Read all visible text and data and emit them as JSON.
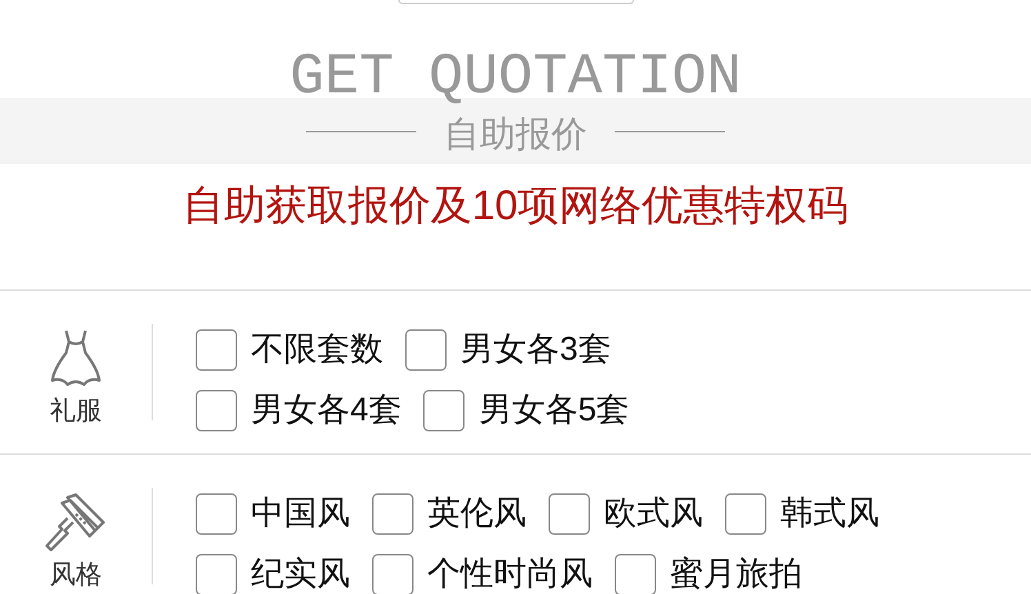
{
  "header": {
    "title": "GET QUOTATION",
    "subtitle": "自助报价",
    "tagline": "自助获取报价及10项网络优惠特权码"
  },
  "sections": [
    {
      "kind": "dress",
      "label": "礼服",
      "rows": [
        [
          {
            "label": "不限套数",
            "checked": false
          },
          {
            "label": "男女各3套",
            "checked": false
          }
        ],
        [
          {
            "label": "男女各4套",
            "checked": false
          },
          {
            "label": "男女各5套",
            "checked": false
          }
        ]
      ]
    },
    {
      "kind": "roller",
      "label": "风格",
      "rows": [
        [
          {
            "label": "中国风",
            "checked": false
          },
          {
            "label": "英伦风",
            "checked": false
          },
          {
            "label": "欧式风",
            "checked": false
          },
          {
            "label": "韩式风",
            "checked": false
          }
        ],
        [
          {
            "label": "纪实风",
            "checked": false
          },
          {
            "label": "个性时尚风",
            "checked": false
          },
          {
            "label": "蜜月旅拍",
            "checked": false
          }
        ]
      ]
    }
  ]
}
